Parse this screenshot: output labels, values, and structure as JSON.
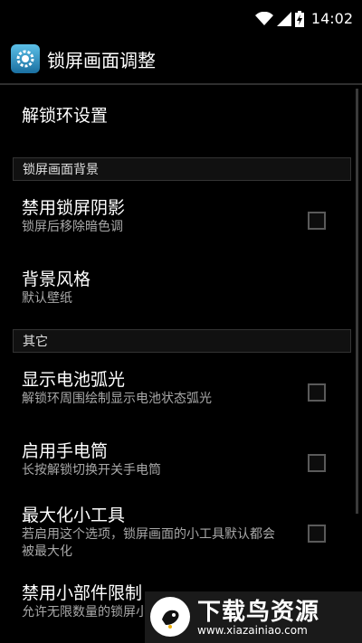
{
  "statusbar": {
    "time": "14:02"
  },
  "actionbar": {
    "title": "锁屏画面调整",
    "icon": "settings-gear-icon"
  },
  "items": {
    "unlock_ring": {
      "title": "解锁环设置"
    },
    "category_background": "锁屏画面背景",
    "disable_shadow": {
      "title": "禁用锁屏阴影",
      "summary": "锁屏后移除暗色调",
      "checked": false
    },
    "background_style": {
      "title": "背景风格",
      "summary": "默认壁纸"
    },
    "category_other": "其它",
    "show_battery_arc": {
      "title": "显示电池弧光",
      "summary": "解锁环周围绘制显示电池状态弧光",
      "checked": false
    },
    "enable_flashlight": {
      "title": "启用手电筒",
      "summary": "长按解锁切换开关手电筒",
      "checked": false
    },
    "maximize_widgets": {
      "title": "最大化小工具",
      "summary": "若启用这个选项，锁屏画面的小工具默认都会被最大化",
      "checked": false
    },
    "disable_widget_limit": {
      "title": "禁用小部件限制",
      "summary": "允许无限数量的锁屏小"
    }
  },
  "watermark": {
    "title": "下载鸟资源",
    "url": "www.xiazainiao.com"
  }
}
